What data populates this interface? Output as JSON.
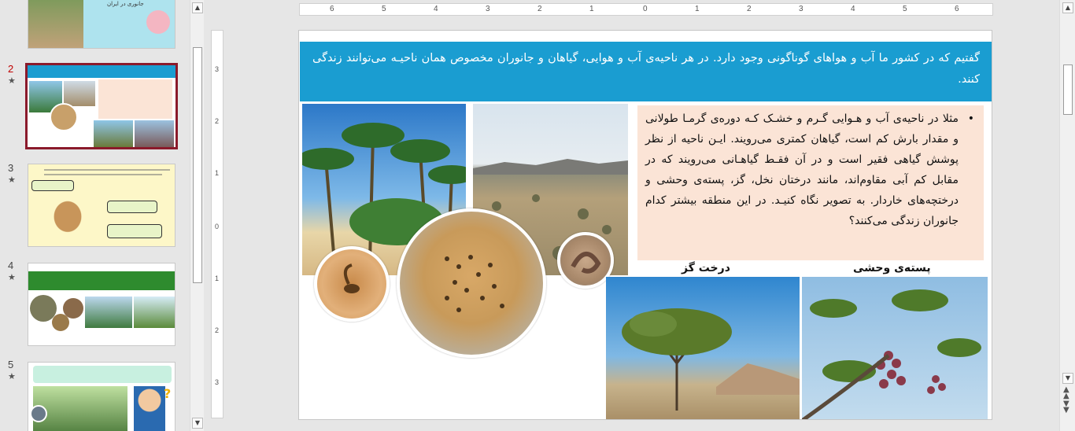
{
  "thumbnails": {
    "slide1": {
      "title": "جانوری در ایران"
    },
    "slide2": {
      "number": "2",
      "star": "★"
    },
    "slide3": {
      "number": "3",
      "star": "★"
    },
    "slide4": {
      "number": "4",
      "star": "★"
    },
    "slide5": {
      "number": "5",
      "star": "★"
    }
  },
  "ruler": {
    "horizontal": [
      "6",
      "5",
      "4",
      "3",
      "2",
      "1",
      "0",
      "1",
      "2",
      "3",
      "4",
      "5",
      "6"
    ],
    "vertical": [
      "3",
      "2",
      "1",
      "0",
      "1",
      "2",
      "3"
    ]
  },
  "slide": {
    "banner_text": "گفتیم که در کشور ما آب و هواهای گوناگونی وجود دارد. در هر ناحیه‌ی آب و هوایی، گیاهان و جانوران مخصوص همان ناحیـه می‌توانند زندگی کنند.",
    "bullet": "•",
    "body_text": "مثلا در ناحیه‌ی آب و هـوایی گـرم و خشـک کـه دوره‌ی گرمـا طولانی و مقدار بارش کم است، گیاهان کمتری می‌رویند. ایـن ناحیه از نظر پوشش گیاهی فقیر است و در آن فقـط گیاهـانی می‌رویند که در مقابل کم آبی مقاوم‌اند، مانند درختان نخل، گز، پسته‌ی وحشی و درختچه‌های خاردار. به تصویر نگاه کنیـد. در این منطقه بیشتر کدام جانوران زندگی می‌کنند؟",
    "caption_gaz": "درخت گز",
    "caption_pistachio": "پسته‌ی وحشی"
  },
  "colors": {
    "banner": "#1a9dd1",
    "textbox": "#fbe4d6",
    "active_thumb_border": "#8b1a2b",
    "active_number": "#c00000"
  }
}
